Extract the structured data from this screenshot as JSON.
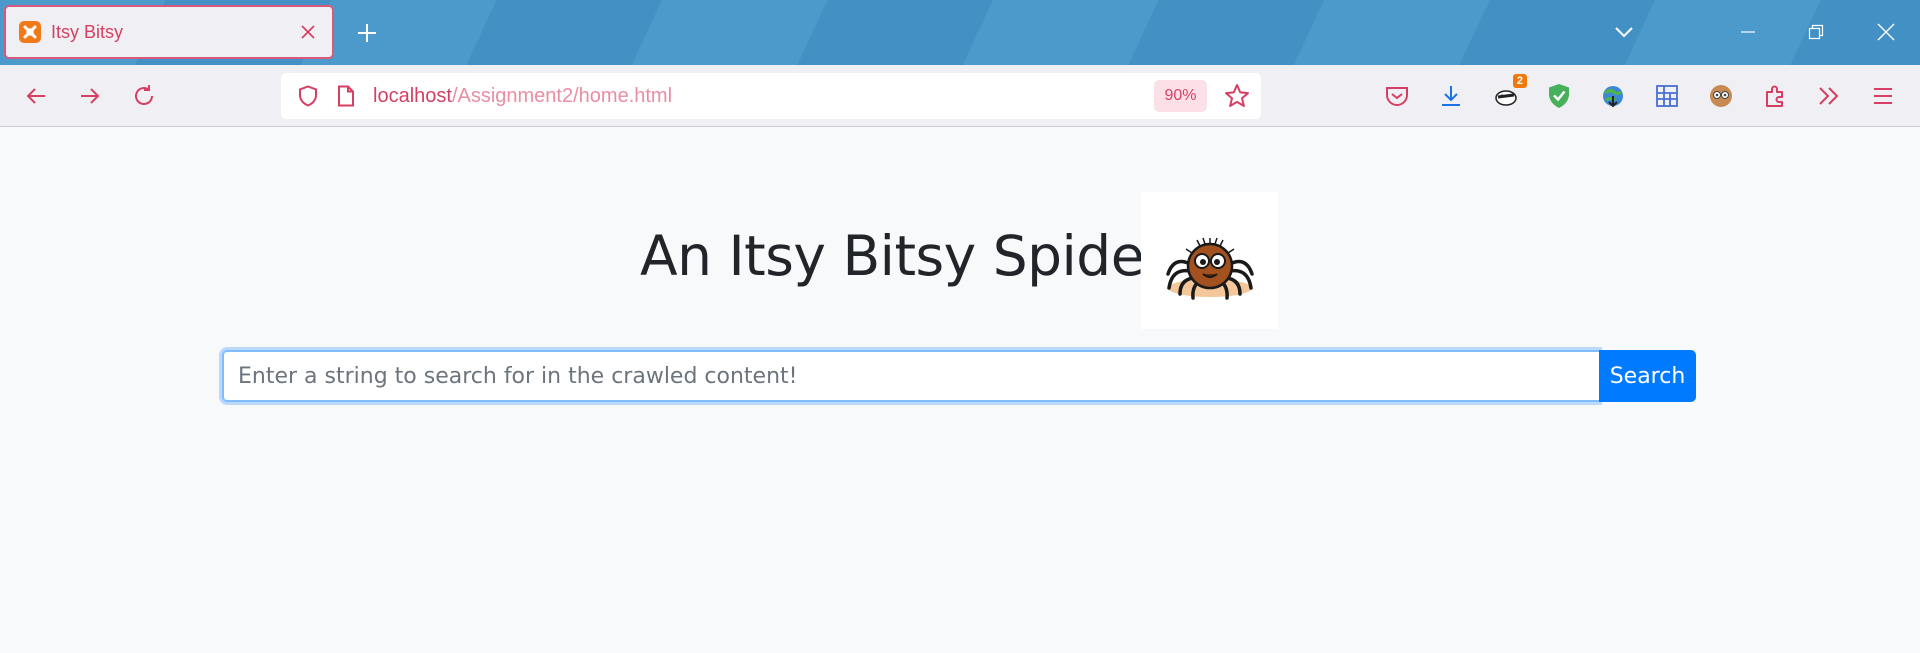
{
  "browser": {
    "tab": {
      "title": "Itsy Bitsy",
      "favicon": "xampp-icon"
    },
    "url": {
      "host": "localhost",
      "path": "/Assignment2/home.html"
    },
    "zoom": "90%",
    "extension_badge": "2",
    "accent_color": "#d63f63"
  },
  "page": {
    "heading": "An Itsy Bitsy Spider",
    "search": {
      "placeholder": "Enter a string to search for in the crawled content!",
      "value": "",
      "button_label": "Search"
    }
  }
}
